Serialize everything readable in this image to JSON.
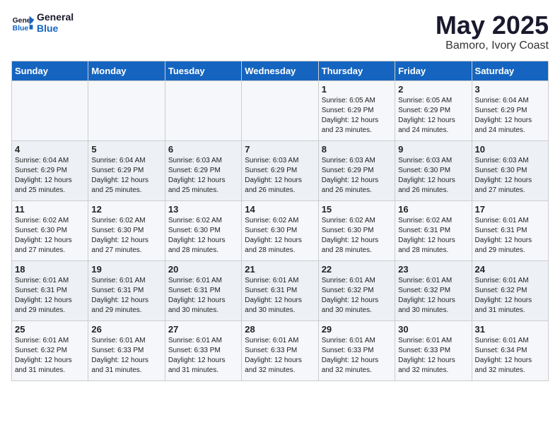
{
  "logo": {
    "name": "General",
    "name2": "Blue"
  },
  "title": "May 2025",
  "subtitle": "Bamoro, Ivory Coast",
  "days_of_week": [
    "Sunday",
    "Monday",
    "Tuesday",
    "Wednesday",
    "Thursday",
    "Friday",
    "Saturday"
  ],
  "weeks": [
    [
      {
        "day": "",
        "info": ""
      },
      {
        "day": "",
        "info": ""
      },
      {
        "day": "",
        "info": ""
      },
      {
        "day": "",
        "info": ""
      },
      {
        "day": "1",
        "info": "Sunrise: 6:05 AM\nSunset: 6:29 PM\nDaylight: 12 hours\nand 23 minutes."
      },
      {
        "day": "2",
        "info": "Sunrise: 6:05 AM\nSunset: 6:29 PM\nDaylight: 12 hours\nand 24 minutes."
      },
      {
        "day": "3",
        "info": "Sunrise: 6:04 AM\nSunset: 6:29 PM\nDaylight: 12 hours\nand 24 minutes."
      }
    ],
    [
      {
        "day": "4",
        "info": "Sunrise: 6:04 AM\nSunset: 6:29 PM\nDaylight: 12 hours\nand 25 minutes."
      },
      {
        "day": "5",
        "info": "Sunrise: 6:04 AM\nSunset: 6:29 PM\nDaylight: 12 hours\nand 25 minutes."
      },
      {
        "day": "6",
        "info": "Sunrise: 6:03 AM\nSunset: 6:29 PM\nDaylight: 12 hours\nand 25 minutes."
      },
      {
        "day": "7",
        "info": "Sunrise: 6:03 AM\nSunset: 6:29 PM\nDaylight: 12 hours\nand 26 minutes."
      },
      {
        "day": "8",
        "info": "Sunrise: 6:03 AM\nSunset: 6:29 PM\nDaylight: 12 hours\nand 26 minutes."
      },
      {
        "day": "9",
        "info": "Sunrise: 6:03 AM\nSunset: 6:30 PM\nDaylight: 12 hours\nand 26 minutes."
      },
      {
        "day": "10",
        "info": "Sunrise: 6:03 AM\nSunset: 6:30 PM\nDaylight: 12 hours\nand 27 minutes."
      }
    ],
    [
      {
        "day": "11",
        "info": "Sunrise: 6:02 AM\nSunset: 6:30 PM\nDaylight: 12 hours\nand 27 minutes."
      },
      {
        "day": "12",
        "info": "Sunrise: 6:02 AM\nSunset: 6:30 PM\nDaylight: 12 hours\nand 27 minutes."
      },
      {
        "day": "13",
        "info": "Sunrise: 6:02 AM\nSunset: 6:30 PM\nDaylight: 12 hours\nand 28 minutes."
      },
      {
        "day": "14",
        "info": "Sunrise: 6:02 AM\nSunset: 6:30 PM\nDaylight: 12 hours\nand 28 minutes."
      },
      {
        "day": "15",
        "info": "Sunrise: 6:02 AM\nSunset: 6:30 PM\nDaylight: 12 hours\nand 28 minutes."
      },
      {
        "day": "16",
        "info": "Sunrise: 6:02 AM\nSunset: 6:31 PM\nDaylight: 12 hours\nand 28 minutes."
      },
      {
        "day": "17",
        "info": "Sunrise: 6:01 AM\nSunset: 6:31 PM\nDaylight: 12 hours\nand 29 minutes."
      }
    ],
    [
      {
        "day": "18",
        "info": "Sunrise: 6:01 AM\nSunset: 6:31 PM\nDaylight: 12 hours\nand 29 minutes."
      },
      {
        "day": "19",
        "info": "Sunrise: 6:01 AM\nSunset: 6:31 PM\nDaylight: 12 hours\nand 29 minutes."
      },
      {
        "day": "20",
        "info": "Sunrise: 6:01 AM\nSunset: 6:31 PM\nDaylight: 12 hours\nand 30 minutes."
      },
      {
        "day": "21",
        "info": "Sunrise: 6:01 AM\nSunset: 6:31 PM\nDaylight: 12 hours\nand 30 minutes."
      },
      {
        "day": "22",
        "info": "Sunrise: 6:01 AM\nSunset: 6:32 PM\nDaylight: 12 hours\nand 30 minutes."
      },
      {
        "day": "23",
        "info": "Sunrise: 6:01 AM\nSunset: 6:32 PM\nDaylight: 12 hours\nand 30 minutes."
      },
      {
        "day": "24",
        "info": "Sunrise: 6:01 AM\nSunset: 6:32 PM\nDaylight: 12 hours\nand 31 minutes."
      }
    ],
    [
      {
        "day": "25",
        "info": "Sunrise: 6:01 AM\nSunset: 6:32 PM\nDaylight: 12 hours\nand 31 minutes."
      },
      {
        "day": "26",
        "info": "Sunrise: 6:01 AM\nSunset: 6:33 PM\nDaylight: 12 hours\nand 31 minutes."
      },
      {
        "day": "27",
        "info": "Sunrise: 6:01 AM\nSunset: 6:33 PM\nDaylight: 12 hours\nand 31 minutes."
      },
      {
        "day": "28",
        "info": "Sunrise: 6:01 AM\nSunset: 6:33 PM\nDaylight: 12 hours\nand 32 minutes."
      },
      {
        "day": "29",
        "info": "Sunrise: 6:01 AM\nSunset: 6:33 PM\nDaylight: 12 hours\nand 32 minutes."
      },
      {
        "day": "30",
        "info": "Sunrise: 6:01 AM\nSunset: 6:33 PM\nDaylight: 12 hours\nand 32 minutes."
      },
      {
        "day": "31",
        "info": "Sunrise: 6:01 AM\nSunset: 6:34 PM\nDaylight: 12 hours\nand 32 minutes."
      }
    ]
  ]
}
